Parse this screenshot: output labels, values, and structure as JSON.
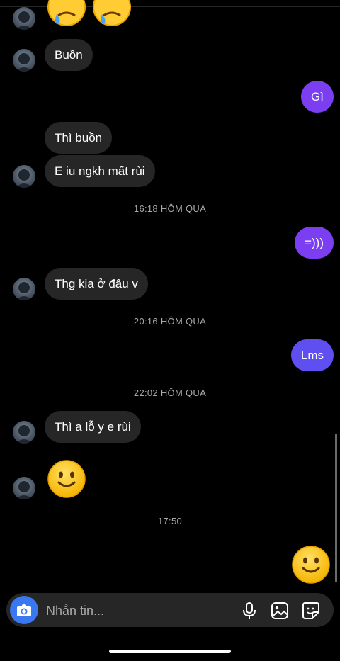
{
  "messages": {
    "m1": "Buồn",
    "m2": "Gì",
    "m3": "Thì buồn",
    "m4": "E iu ngkh mất rùi",
    "m5": "=)))",
    "m6": "Thg kia ở đâu v",
    "m7": "Lms",
    "m8": "Thì a lỗ y e rùi"
  },
  "timestamps": {
    "t1": "16:18 HÔM QUA",
    "t2": "20:16 HÔM QUA",
    "t3": "22:02 HÔM QUA",
    "t4": "17:50"
  },
  "emojis": {
    "top": "sad-but-relieved-face",
    "received": "slightly-smiling-face",
    "sent": "slightly-smiling-face"
  },
  "composer": {
    "placeholder": "Nhắn tin...",
    "icons": [
      "camera-icon",
      "microphone-icon",
      "image-icon",
      "sticker-icon"
    ]
  },
  "colors": {
    "background": "#000000",
    "incoming_bubble": "#262626",
    "outgoing_purple": "#7b3ef0",
    "outgoing_indigo": "#5f4ff0",
    "camera_button": "#3a78f2"
  }
}
